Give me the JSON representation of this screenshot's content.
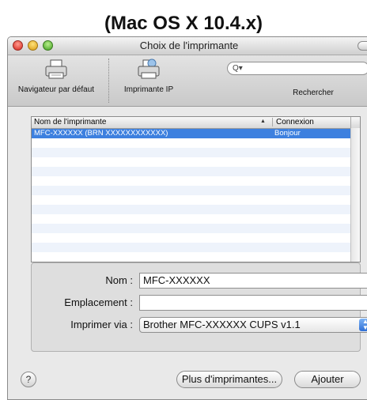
{
  "caption": "(Mac OS X 10.4.x)",
  "window": {
    "title": "Choix de l'imprimante"
  },
  "toolbar": {
    "default_browser_label": "Navigateur par défaut",
    "ip_printer_label": "Imprimante IP",
    "search_label": "Rechercher",
    "search_placeholder": ""
  },
  "printer_list": {
    "columns": [
      "Nom de l'imprimante",
      "Connexion"
    ],
    "rows": [
      {
        "name": "MFC-XXXXXX (BRN XXXXXXXXXXXX)",
        "connection": "Bonjour",
        "selected": true
      }
    ]
  },
  "details": {
    "name_label": "Nom :",
    "name_value": "MFC-XXXXXX",
    "location_label": "Emplacement :",
    "location_value": "",
    "print_via_label": "Imprimer via :",
    "print_via_value": "Brother MFC-XXXXXX CUPS v1.1"
  },
  "buttons": {
    "help_label": "?",
    "more_printers_label": "Plus d'imprimantes...",
    "add_label": "Ajouter"
  },
  "colors": {
    "selection": "#3d80df",
    "accent": "#2f6fd6"
  }
}
